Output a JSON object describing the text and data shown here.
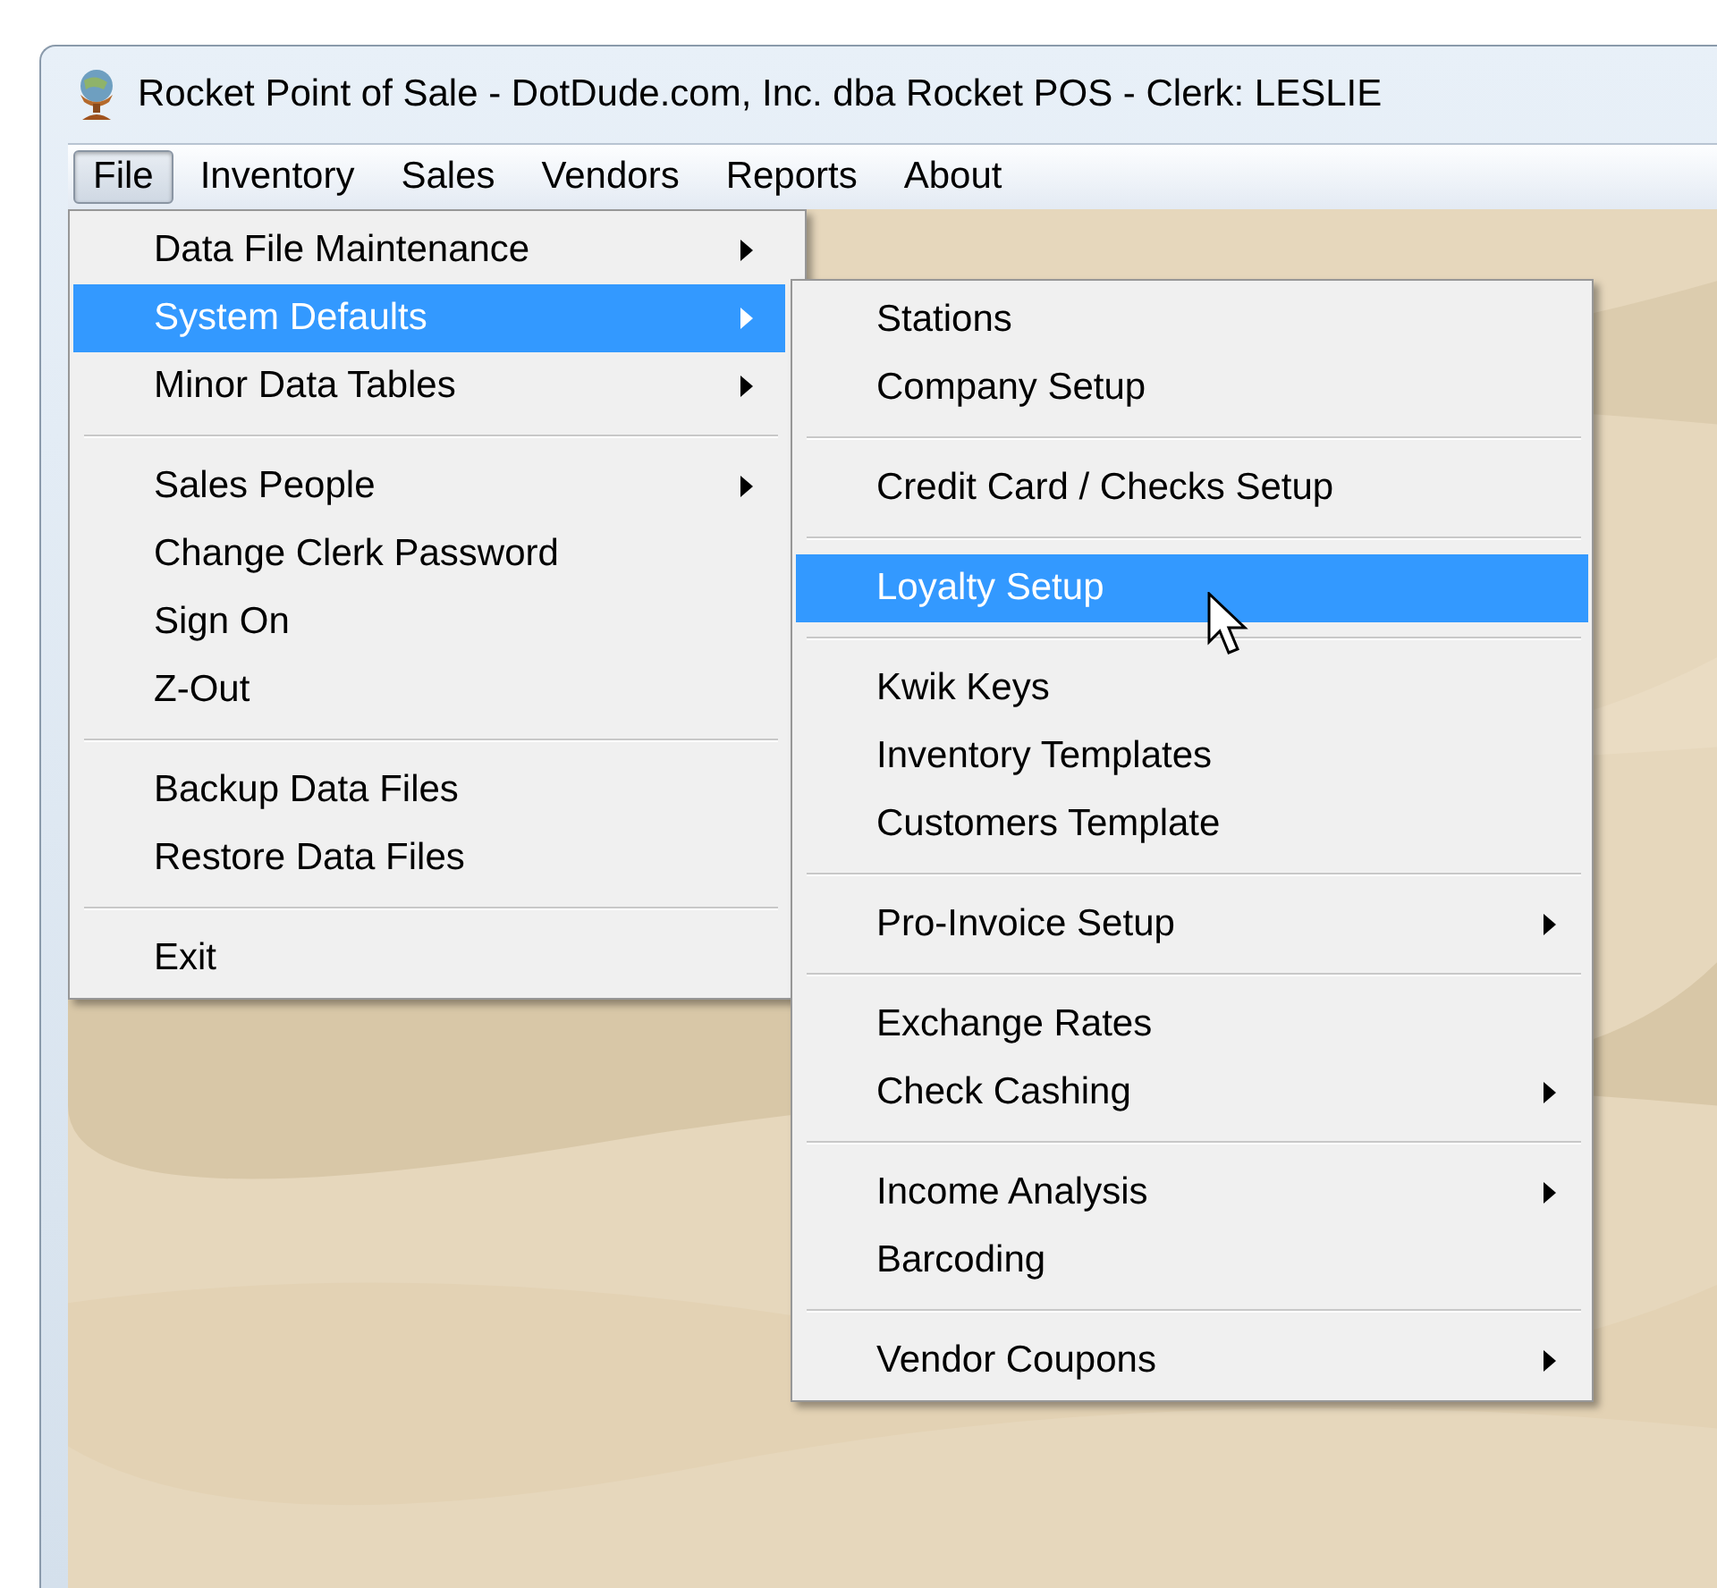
{
  "window": {
    "title": "Rocket Point of Sale - DotDude.com, Inc. dba Rocket POS - Clerk: LESLIE"
  },
  "menu_bar": [
    {
      "label": "File",
      "selected": true
    },
    {
      "label": "Inventory",
      "selected": false
    },
    {
      "label": "Sales",
      "selected": false
    },
    {
      "label": "Vendors",
      "selected": false
    },
    {
      "label": "Reports",
      "selected": false
    },
    {
      "label": "About",
      "selected": false
    }
  ],
  "file_menu": [
    {
      "kind": "item",
      "label": "Data File Maintenance",
      "submenu": true,
      "selected": false
    },
    {
      "kind": "item",
      "label": "System Defaults",
      "submenu": true,
      "selected": true
    },
    {
      "kind": "item",
      "label": "Minor Data Tables",
      "submenu": true,
      "selected": false
    },
    {
      "kind": "separator"
    },
    {
      "kind": "item",
      "label": "Sales People",
      "submenu": true,
      "selected": false
    },
    {
      "kind": "item",
      "label": "Change Clerk Password",
      "submenu": false,
      "selected": false
    },
    {
      "kind": "item",
      "label": "Sign On",
      "submenu": false,
      "selected": false
    },
    {
      "kind": "item",
      "label": "Z-Out",
      "submenu": false,
      "selected": false
    },
    {
      "kind": "separator"
    },
    {
      "kind": "item",
      "label": "Backup Data Files",
      "submenu": false,
      "selected": false
    },
    {
      "kind": "item",
      "label": "Restore Data Files",
      "submenu": false,
      "selected": false
    },
    {
      "kind": "separator"
    },
    {
      "kind": "item",
      "label": "Exit",
      "submenu": false,
      "selected": false
    }
  ],
  "system_defaults_menu": [
    {
      "kind": "item",
      "label": "Stations",
      "submenu": false,
      "selected": false
    },
    {
      "kind": "item",
      "label": "Company Setup",
      "submenu": false,
      "selected": false
    },
    {
      "kind": "separator"
    },
    {
      "kind": "item",
      "label": "Credit Card / Checks Setup",
      "submenu": false,
      "selected": false
    },
    {
      "kind": "separator"
    },
    {
      "kind": "item",
      "label": "Loyalty Setup",
      "submenu": false,
      "selected": true
    },
    {
      "kind": "separator"
    },
    {
      "kind": "item",
      "label": "Kwik Keys",
      "submenu": false,
      "selected": false
    },
    {
      "kind": "item",
      "label": "Inventory Templates",
      "submenu": false,
      "selected": false
    },
    {
      "kind": "item",
      "label": "Customers Template",
      "submenu": false,
      "selected": false
    },
    {
      "kind": "separator"
    },
    {
      "kind": "item",
      "label": "Pro-Invoice Setup",
      "submenu": true,
      "selected": false
    },
    {
      "kind": "separator"
    },
    {
      "kind": "item",
      "label": "Exchange Rates",
      "submenu": false,
      "selected": false
    },
    {
      "kind": "item",
      "label": "Check Cashing",
      "submenu": true,
      "selected": false
    },
    {
      "kind": "separator"
    },
    {
      "kind": "item",
      "label": "Income Analysis",
      "submenu": true,
      "selected": false
    },
    {
      "kind": "item",
      "label": "Barcoding",
      "submenu": false,
      "selected": false
    },
    {
      "kind": "separator"
    },
    {
      "kind": "item",
      "label": "Vendor Coupons",
      "submenu": true,
      "selected": false
    }
  ]
}
